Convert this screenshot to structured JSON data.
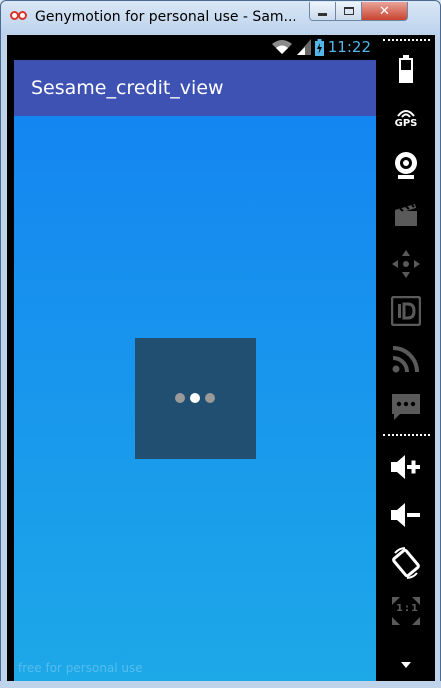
{
  "window": {
    "title": "Genymotion for personal use - Sam..."
  },
  "statusbar": {
    "time": "11:22"
  },
  "app": {
    "title": "Sesame_credit_view"
  },
  "watermark": "free for personal use",
  "toolbar": {
    "gps_label": "GPS",
    "ratio_label": "1:1",
    "items": [
      "battery-icon",
      "gps-icon",
      "webcam-icon",
      "video-capture-icon",
      "dpad-icon",
      "id-icon",
      "rss-icon",
      "sms-icon",
      "volume-up-icon",
      "volume-down-icon",
      "rotate-icon",
      "pixel-perfect-icon"
    ]
  },
  "loader": {
    "dot_colors": [
      "#9a9a9a",
      "#ffffff",
      "#9a9a9a"
    ]
  },
  "colors": {
    "action_bar": "#3e52b4",
    "content_top": "#1486f1",
    "content_bottom": "#1da8e8",
    "loader_box": "#204f72",
    "clock": "#52b6e8"
  }
}
